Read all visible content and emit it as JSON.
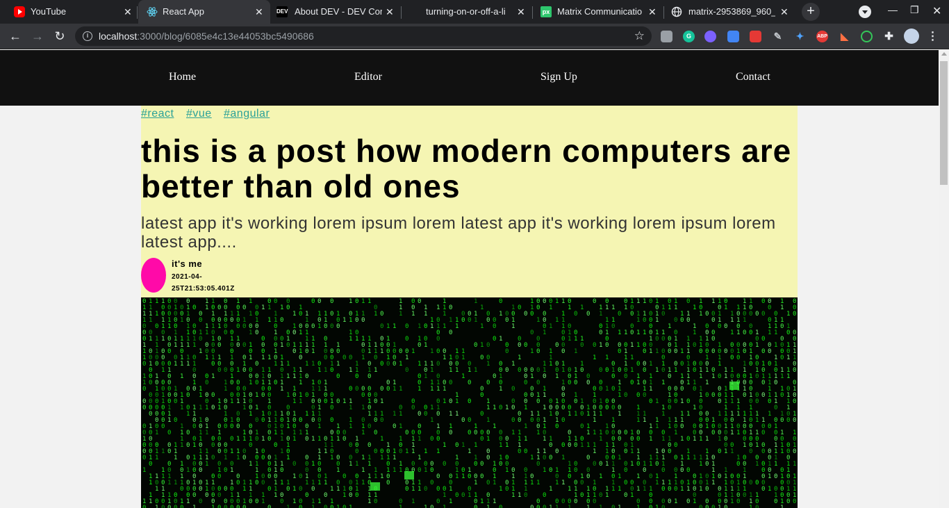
{
  "browser": {
    "tabs": [
      {
        "label": "YouTube",
        "icon": "youtube-icon"
      },
      {
        "label": "React App",
        "icon": "react-icon"
      },
      {
        "label": "About DEV - DEV Com",
        "icon": "dev-icon"
      },
      {
        "label": "turning-on-or-off-a-li",
        "icon": "blank-page-icon"
      },
      {
        "label": "Matrix Communicatio",
        "icon": "pixabay-icon"
      },
      {
        "label": "matrix-2953869_960_",
        "icon": "globe-icon"
      }
    ],
    "url_host": "localhost",
    "url_path": ":3000/blog/6085e4c13e44053bc5490686",
    "extensions": [
      "ext-icon",
      "grammarly-icon",
      "orb-icon",
      "translate-icon",
      "video-icon",
      "pen-icon",
      "bird-icon",
      "abp-icon",
      "ext-icon",
      "ext-icon",
      "puzzle-icon",
      "profile-avatar"
    ],
    "extension_labels": {
      "grammarly": "G",
      "abp": "ABP"
    }
  },
  "nav": {
    "items": [
      "Home",
      "Editor",
      "Sign Up",
      "Contact"
    ]
  },
  "post": {
    "tags": [
      "#react",
      "#vue",
      "#angular"
    ],
    "title": "this is a post how modern computers are better than old ones",
    "subtitle": "latest app it's working lorem ipsum lorem latest app it's working lorem ipsum lorem latest app....",
    "author_name": "it's me",
    "date": "2021-04-25T21:53:05.401Z",
    "avatar_color": "#ff0aa8",
    "header_bg": "#f5f5b3",
    "tag_color": "#2aa198"
  },
  "cover_image": {
    "subject": "green digital matrix code rain tunnel",
    "glyphs": "01",
    "accent": "#3cff3c",
    "bg": "#020602"
  }
}
